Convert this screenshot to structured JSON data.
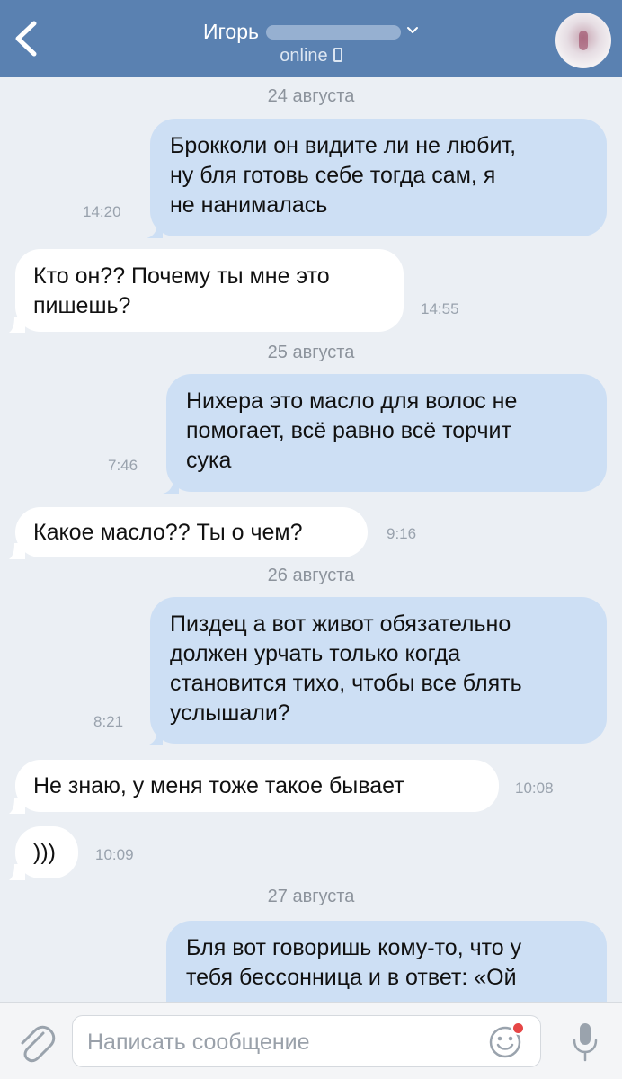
{
  "header": {
    "contact_first_name": "Игорь",
    "status": "online",
    "colors": {
      "bar": "#5a81b1",
      "text": "#ffffff"
    },
    "icons": {
      "back": "chevron-left-icon",
      "expand": "chevron-down-icon",
      "device": "phone-icon"
    }
  },
  "dates": {
    "d1": "24 августа",
    "d2": "25 августа",
    "d3": "26 августа",
    "d4": "27 августа"
  },
  "messages": {
    "m1": {
      "direction": "outgoing",
      "lines": [
        "Брокколи он видите ли не любит,",
        "ну бля готовь себе тогда сам, я",
        "не нанималась"
      ],
      "time": "14:20"
    },
    "m2": {
      "direction": "incoming",
      "lines": [
        "Кто он?? Почему ты мне это",
        "пишешь?"
      ],
      "time": "14:55"
    },
    "m3": {
      "direction": "outgoing",
      "lines": [
        "Нихера это масло для волос не",
        "помогает,  всё равно всё торчит",
        "сука"
      ],
      "time": "7:46"
    },
    "m4": {
      "direction": "incoming",
      "lines": [
        "Какое масло?? Ты о чем?"
      ],
      "time": "9:16"
    },
    "m5": {
      "direction": "outgoing",
      "lines": [
        "Пиздец а вот живот обязательно",
        "должен урчать только когда",
        "становится тихо, чтобы все блять",
        "услышали?"
      ],
      "time": "8:21"
    },
    "m6": {
      "direction": "incoming",
      "lines": [
        "Не знаю, у меня тоже такое бывает"
      ],
      "time": "10:08"
    },
    "m7": {
      "direction": "incoming",
      "lines": [
        ")))"
      ],
      "time": "10:09"
    },
    "m8": {
      "direction": "outgoing",
      "lines": [
        "Бля вот говоришь кому-то, что у",
        "тебя бессонница и в ответ: «Ой"
      ],
      "time": ""
    }
  },
  "colors": {
    "background": "#ebeff4",
    "incoming_bubble": "#ffffff",
    "outgoing_bubble": "#cddff4",
    "date_text": "#8c939c",
    "time_text": "#99a2ad",
    "notification_dot": "#e64646"
  },
  "composer": {
    "placeholder": "Написать сообщение",
    "value": "",
    "icons": {
      "attach": "paperclip-icon",
      "emoji": "smiley-icon",
      "mic": "microphone-icon"
    }
  }
}
